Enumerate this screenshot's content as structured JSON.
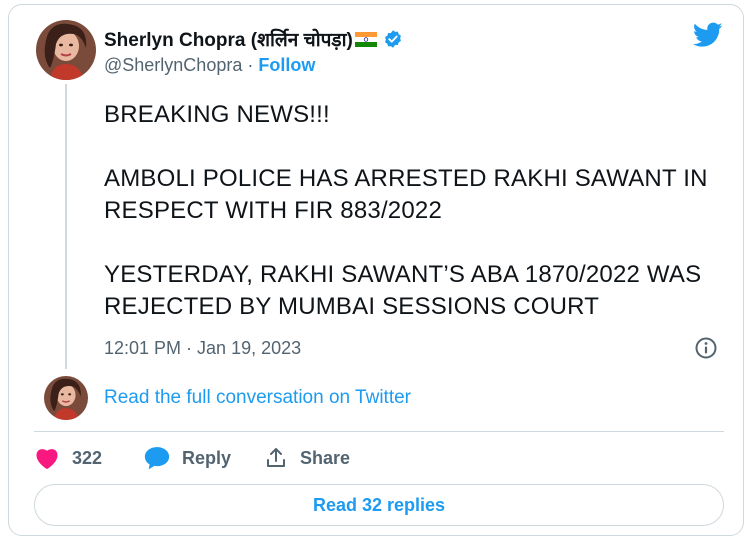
{
  "author": {
    "display_name": "Sherlyn Chopra (शर्लिन चोपड़ा)",
    "handle": "@SherlynChopra",
    "separator": " · ",
    "follow_label": "Follow"
  },
  "tweet": {
    "text": "BREAKING NEWS!!!\n\nAMBOLI POLICE HAS ARRESTED RAKHI SAWANT IN RESPECT WITH FIR 883/2022\n\nYESTERDAY, RAKHI SAWANT’S ABA 1870/2022 WAS REJECTED BY MUMBAI SESSIONS COURT",
    "timestamp": "12:01 PM · Jan 19, 2023"
  },
  "conversation": {
    "read_full_label": "Read the full conversation on Twitter"
  },
  "actions": {
    "likes_count": "322",
    "reply_label": "Reply",
    "share_label": "Share"
  },
  "footer": {
    "read_replies_label": "Read 32 replies"
  },
  "icons": {
    "like": "heart-icon",
    "reply": "speech-bubble-icon",
    "share": "share-upload-icon",
    "info": "info-icon",
    "brand": "twitter-bird-icon",
    "verified": "verified-badge-icon",
    "flag": "india-flag-icon"
  },
  "colors": {
    "accent": "#1d9bf0",
    "like": "#f91880",
    "text": "#0f1419",
    "muted": "#536471",
    "border": "#cfd9de"
  }
}
